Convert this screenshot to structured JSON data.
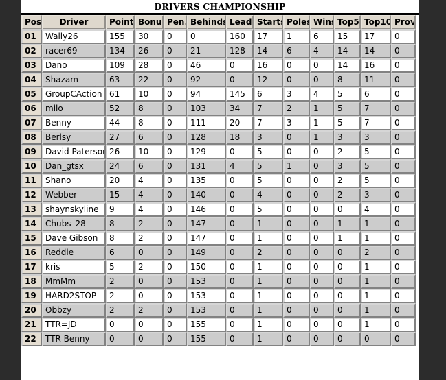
{
  "page": {
    "title": "DRIVERS CHAMPIONSHIP",
    "background_color": "#2c2c2c",
    "panel_color": "#ffffff",
    "header_cell_color": "#ded8cd",
    "pos_cell_color": "#e5ded2",
    "row_alt_color": "#cccccc"
  },
  "table": {
    "columns": [
      {
        "key": "pos",
        "label": "Pos"
      },
      {
        "key": "driver",
        "label": "Driver"
      },
      {
        "key": "points",
        "label": "Points"
      },
      {
        "key": "bonus",
        "label": "Bonus"
      },
      {
        "key": "pen",
        "label": "Pen."
      },
      {
        "key": "behinds",
        "label": "Behinds"
      },
      {
        "key": "leads",
        "label": "Leads"
      },
      {
        "key": "starts",
        "label": "Starts"
      },
      {
        "key": "poles",
        "label": "Poles"
      },
      {
        "key": "wins",
        "label": "Wins"
      },
      {
        "key": "top5",
        "label": "Top5"
      },
      {
        "key": "top10",
        "label": "Top10"
      },
      {
        "key": "prov",
        "label": "Prov."
      }
    ],
    "rows": [
      {
        "pos": "01",
        "driver": "Wally26",
        "points": "155",
        "bonus": "30",
        "pen": "0",
        "behinds": "0",
        "leads": "160",
        "starts": "17",
        "poles": "1",
        "wins": "6",
        "top5": "15",
        "top10": "17",
        "prov": "0"
      },
      {
        "pos": "02",
        "driver": "racer69",
        "points": "134",
        "bonus": "26",
        "pen": "0",
        "behinds": "21",
        "leads": "128",
        "starts": "14",
        "poles": "6",
        "wins": "4",
        "top5": "14",
        "top10": "14",
        "prov": "0"
      },
      {
        "pos": "03",
        "driver": "Dano",
        "points": "109",
        "bonus": "28",
        "pen": "0",
        "behinds": "46",
        "leads": "0",
        "starts": "16",
        "poles": "0",
        "wins": "0",
        "top5": "14",
        "top10": "16",
        "prov": "0"
      },
      {
        "pos": "04",
        "driver": "Shazam",
        "points": "63",
        "bonus": "22",
        "pen": "0",
        "behinds": "92",
        "leads": "0",
        "starts": "12",
        "poles": "0",
        "wins": "0",
        "top5": "8",
        "top10": "11",
        "prov": "0"
      },
      {
        "pos": "05",
        "driver": "GroupCAction",
        "points": "61",
        "bonus": "10",
        "pen": "0",
        "behinds": "94",
        "leads": "145",
        "starts": "6",
        "poles": "3",
        "wins": "4",
        "top5": "5",
        "top10": "6",
        "prov": "0"
      },
      {
        "pos": "06",
        "driver": "milo",
        "points": "52",
        "bonus": "8",
        "pen": "0",
        "behinds": "103",
        "leads": "34",
        "starts": "7",
        "poles": "2",
        "wins": "1",
        "top5": "5",
        "top10": "7",
        "prov": "0"
      },
      {
        "pos": "07",
        "driver": "Benny",
        "points": "44",
        "bonus": "8",
        "pen": "0",
        "behinds": "111",
        "leads": "20",
        "starts": "7",
        "poles": "3",
        "wins": "1",
        "top5": "5",
        "top10": "7",
        "prov": "0"
      },
      {
        "pos": "08",
        "driver": "Berlsy",
        "points": "27",
        "bonus": "6",
        "pen": "0",
        "behinds": "128",
        "leads": "18",
        "starts": "3",
        "poles": "0",
        "wins": "1",
        "top5": "3",
        "top10": "3",
        "prov": "0"
      },
      {
        "pos": "09",
        "driver": "David Paterson",
        "points": "26",
        "bonus": "10",
        "pen": "0",
        "behinds": "129",
        "leads": "0",
        "starts": "5",
        "poles": "0",
        "wins": "0",
        "top5": "2",
        "top10": "5",
        "prov": "0"
      },
      {
        "pos": "10",
        "driver": "Dan_gtsx",
        "points": "24",
        "bonus": "6",
        "pen": "0",
        "behinds": "131",
        "leads": "4",
        "starts": "5",
        "poles": "1",
        "wins": "0",
        "top5": "3",
        "top10": "5",
        "prov": "0"
      },
      {
        "pos": "11",
        "driver": "Shano",
        "points": "20",
        "bonus": "4",
        "pen": "0",
        "behinds": "135",
        "leads": "0",
        "starts": "5",
        "poles": "0",
        "wins": "0",
        "top5": "2",
        "top10": "5",
        "prov": "0"
      },
      {
        "pos": "12",
        "driver": "Webber",
        "points": "15",
        "bonus": "4",
        "pen": "0",
        "behinds": "140",
        "leads": "0",
        "starts": "4",
        "poles": "0",
        "wins": "0",
        "top5": "2",
        "top10": "3",
        "prov": "0"
      },
      {
        "pos": "13",
        "driver": "shaynskyline",
        "points": "9",
        "bonus": "4",
        "pen": "0",
        "behinds": "146",
        "leads": "0",
        "starts": "5",
        "poles": "0",
        "wins": "0",
        "top5": "0",
        "top10": "4",
        "prov": "0"
      },
      {
        "pos": "14",
        "driver": "Chubs_28",
        "points": "8",
        "bonus": "2",
        "pen": "0",
        "behinds": "147",
        "leads": "0",
        "starts": "1",
        "poles": "0",
        "wins": "0",
        "top5": "1",
        "top10": "1",
        "prov": "0"
      },
      {
        "pos": "15",
        "driver": "Dave Gibson",
        "points": "8",
        "bonus": "2",
        "pen": "0",
        "behinds": "147",
        "leads": "0",
        "starts": "1",
        "poles": "0",
        "wins": "0",
        "top5": "1",
        "top10": "1",
        "prov": "0"
      },
      {
        "pos": "16",
        "driver": "Reddie",
        "points": "6",
        "bonus": "0",
        "pen": "0",
        "behinds": "149",
        "leads": "0",
        "starts": "2",
        "poles": "0",
        "wins": "0",
        "top5": "0",
        "top10": "2",
        "prov": "0"
      },
      {
        "pos": "17",
        "driver": "kris",
        "points": "5",
        "bonus": "2",
        "pen": "0",
        "behinds": "150",
        "leads": "0",
        "starts": "1",
        "poles": "0",
        "wins": "0",
        "top5": "0",
        "top10": "1",
        "prov": "0"
      },
      {
        "pos": "18",
        "driver": "MmMm",
        "points": "2",
        "bonus": "0",
        "pen": "0",
        "behinds": "153",
        "leads": "0",
        "starts": "1",
        "poles": "0",
        "wins": "0",
        "top5": "0",
        "top10": "1",
        "prov": "0"
      },
      {
        "pos": "19",
        "driver": "HARD2STOP",
        "points": "2",
        "bonus": "0",
        "pen": "0",
        "behinds": "153",
        "leads": "0",
        "starts": "1",
        "poles": "0",
        "wins": "0",
        "top5": "0",
        "top10": "1",
        "prov": "0"
      },
      {
        "pos": "20",
        "driver": "Obbzy",
        "points": "2",
        "bonus": "2",
        "pen": "0",
        "behinds": "153",
        "leads": "0",
        "starts": "1",
        "poles": "0",
        "wins": "0",
        "top5": "0",
        "top10": "1",
        "prov": "0"
      },
      {
        "pos": "21",
        "driver": "TTR=JD",
        "points": "0",
        "bonus": "0",
        "pen": "0",
        "behinds": "155",
        "leads": "0",
        "starts": "1",
        "poles": "0",
        "wins": "0",
        "top5": "0",
        "top10": "1",
        "prov": "0"
      },
      {
        "pos": "22",
        "driver": "TTR Benny",
        "points": "0",
        "bonus": "0",
        "pen": "0",
        "behinds": "155",
        "leads": "0",
        "starts": "1",
        "poles": "0",
        "wins": "0",
        "top5": "0",
        "top10": "0",
        "prov": "0"
      }
    ]
  }
}
